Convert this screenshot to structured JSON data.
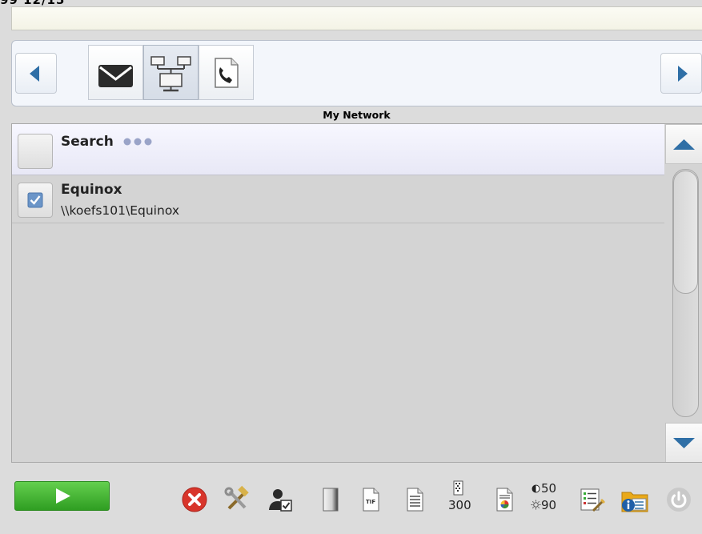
{
  "header": {
    "top_fragment": "99 12/15"
  },
  "destinations": {
    "section_title": "My Network",
    "tabs": [
      {
        "name": "email",
        "icon": "envelope-icon"
      },
      {
        "name": "network",
        "icon": "network-icon",
        "active": true
      },
      {
        "name": "fax",
        "icon": "fax-phone-icon"
      }
    ]
  },
  "list": {
    "search_label": "Search",
    "items": [
      {
        "name": "Equinox",
        "path": "\\\\koefs101\\Equinox",
        "checked": true
      }
    ]
  },
  "toolbar": {
    "resolution": "300",
    "contrast": "50",
    "brightness": "90",
    "icons": [
      "cancel-icon",
      "tools-icon",
      "user-icon",
      "page-icon",
      "tif-icon",
      "document-icon",
      "resolution-icon",
      "color-document-icon",
      "contrast-icon",
      "settings-list-icon",
      "info-icon",
      "power-icon"
    ]
  },
  "colors": {
    "accent_blue": "#2f6fa6",
    "start_green": "#3fae30",
    "cancel_red": "#d8352b"
  }
}
